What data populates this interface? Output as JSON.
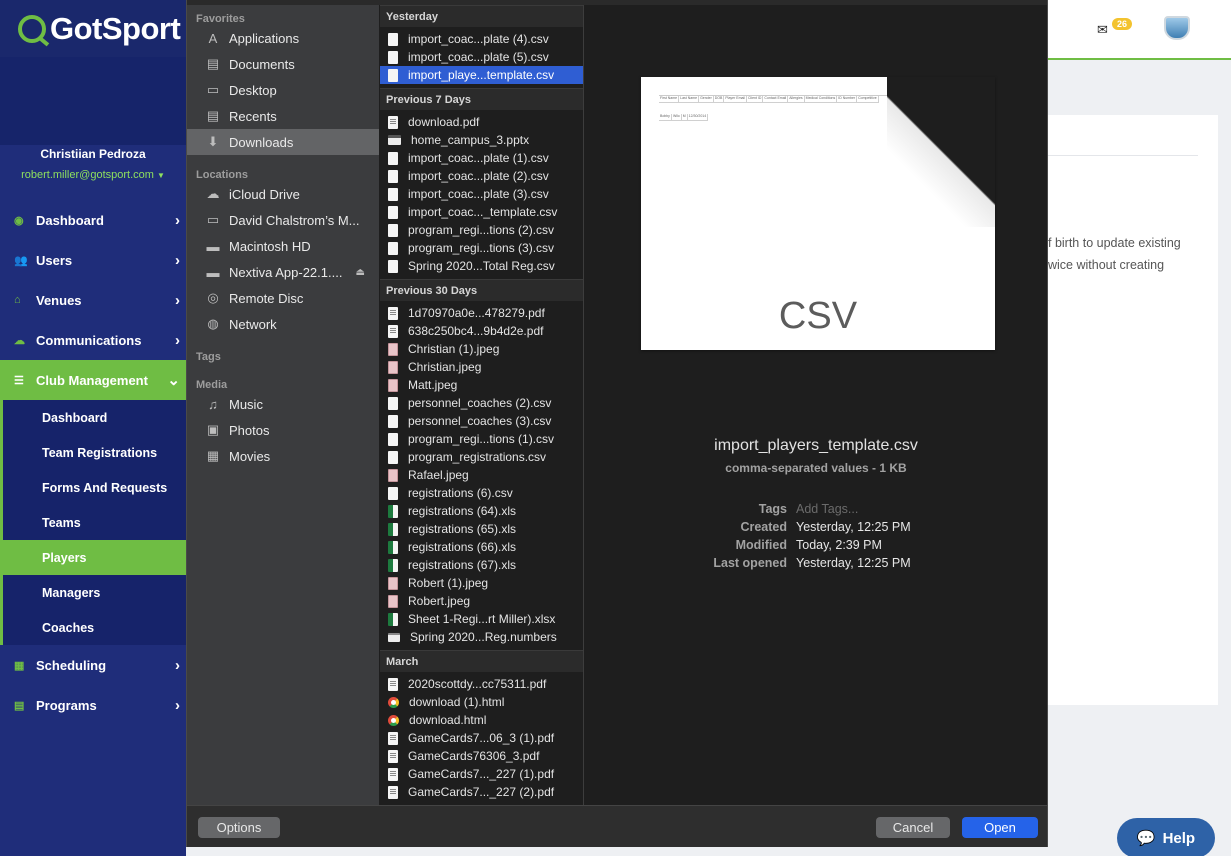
{
  "app": {
    "logo_text": "GotSport",
    "user_name": "Christiian Pedroza",
    "user_email": "robert.miller@gotsport.com",
    "nav": [
      {
        "label": "Dashboard",
        "icon": "dashboard-icon"
      },
      {
        "label": "Users",
        "icon": "users-icon"
      },
      {
        "label": "Venues",
        "icon": "home-icon"
      },
      {
        "label": "Communications",
        "icon": "chat-icon"
      },
      {
        "label": "Club Management",
        "icon": "list-icon"
      }
    ],
    "subnav": [
      "Dashboard",
      "Team Registrations",
      "Forms And Requests",
      "Teams",
      "Players",
      "Managers",
      "Coaches"
    ],
    "nav_bottom": [
      {
        "label": "Scheduling",
        "icon": "calendar-icon"
      },
      {
        "label": "Programs",
        "icon": "document-icon"
      }
    ],
    "mail_count": "26",
    "content_line1": "f birth to update existing",
    "content_line2": "wice without creating",
    "help_label": "Help"
  },
  "dialog": {
    "sidebar": {
      "favorites_heading": "Favorites",
      "favorites": [
        {
          "label": "Applications",
          "icon": "applications-icon"
        },
        {
          "label": "Documents",
          "icon": "documents-icon"
        },
        {
          "label": "Desktop",
          "icon": "desktop-icon"
        },
        {
          "label": "Recents",
          "icon": "recents-icon"
        },
        {
          "label": "Downloads",
          "icon": "downloads-icon"
        }
      ],
      "locations_heading": "Locations",
      "locations": [
        {
          "label": "iCloud Drive",
          "icon": "cloud-icon"
        },
        {
          "label": "David Chalstrom’s M...",
          "icon": "computer-icon"
        },
        {
          "label": "Macintosh HD",
          "icon": "disk-icon"
        },
        {
          "label": "Nextiva App-22.1....",
          "icon": "disk-icon"
        },
        {
          "label": "Remote Disc",
          "icon": "disc-icon"
        },
        {
          "label": "Network",
          "icon": "network-icon"
        }
      ],
      "tags_heading": "Tags",
      "media_heading": "Media",
      "media": [
        {
          "label": "Music",
          "icon": "music-icon"
        },
        {
          "label": "Photos",
          "icon": "camera-icon"
        },
        {
          "label": "Movies",
          "icon": "film-icon"
        }
      ]
    },
    "groups": [
      {
        "heading": "Yesterday",
        "files": [
          {
            "name": "import_coac...plate (4).csv",
            "type": "csv"
          },
          {
            "name": "import_coac...plate (5).csv",
            "type": "csv"
          },
          {
            "name": "import_playe...template.csv",
            "type": "csv",
            "selected": true
          }
        ]
      },
      {
        "heading": "Previous 7 Days",
        "files": [
          {
            "name": "download.pdf",
            "type": "pdf"
          },
          {
            "name": "home_campus_3.pptx",
            "type": "pptx"
          },
          {
            "name": "import_coac...plate (1).csv",
            "type": "csv"
          },
          {
            "name": "import_coac...plate (2).csv",
            "type": "csv"
          },
          {
            "name": "import_coac...plate (3).csv",
            "type": "csv"
          },
          {
            "name": "import_coac..._template.csv",
            "type": "csv"
          },
          {
            "name": "program_regi...tions (2).csv",
            "type": "csv"
          },
          {
            "name": "program_regi...tions (3).csv",
            "type": "csv"
          },
          {
            "name": "Spring 2020...Total Reg.csv",
            "type": "csv"
          }
        ]
      },
      {
        "heading": "Previous 30 Days",
        "files": [
          {
            "name": "1d70970a0e...478279.pdf",
            "type": "pdf"
          },
          {
            "name": "638c250bc4...9b4d2e.pdf",
            "type": "pdf"
          },
          {
            "name": "Christian (1).jpeg",
            "type": "jpeg"
          },
          {
            "name": "Christian.jpeg",
            "type": "jpeg"
          },
          {
            "name": "Matt.jpeg",
            "type": "jpeg"
          },
          {
            "name": "personnel_coaches (2).csv",
            "type": "csv"
          },
          {
            "name": "personnel_coaches (3).csv",
            "type": "csv"
          },
          {
            "name": "program_regi...tions (1).csv",
            "type": "csv"
          },
          {
            "name": "program_registrations.csv",
            "type": "csv"
          },
          {
            "name": "Rafael.jpeg",
            "type": "jpeg"
          },
          {
            "name": "registrations (6).csv",
            "type": "csv"
          },
          {
            "name": "registrations (64).xls",
            "type": "xls"
          },
          {
            "name": "registrations (65).xls",
            "type": "xls"
          },
          {
            "name": "registrations (66).xls",
            "type": "xls"
          },
          {
            "name": "registrations (67).xls",
            "type": "xls"
          },
          {
            "name": "Robert (1).jpeg",
            "type": "jpeg"
          },
          {
            "name": "Robert.jpeg",
            "type": "jpeg"
          },
          {
            "name": "Sheet 1-Regi...rt Miller).xlsx",
            "type": "xls"
          },
          {
            "name": "Spring 2020...Reg.numbers",
            "type": "numbers"
          }
        ]
      },
      {
        "heading": "March",
        "files": [
          {
            "name": "2020scottdy...cc75311.pdf",
            "type": "pdf"
          },
          {
            "name": "download (1).html",
            "type": "html"
          },
          {
            "name": "download.html",
            "type": "html"
          },
          {
            "name": "GameCards7...06_3 (1).pdf",
            "type": "pdf"
          },
          {
            "name": "GameCards76306_3.pdf",
            "type": "pdf"
          },
          {
            "name": "GameCards7..._227 (1).pdf",
            "type": "pdf"
          },
          {
            "name": "GameCards7..._227 (2).pdf",
            "type": "pdf"
          }
        ]
      }
    ],
    "preview": {
      "thumb_ext": "CSV",
      "thumb_headers": [
        "First Name",
        "Last Name",
        "Gender",
        "DOB",
        "Player Email",
        "Client ID",
        "Contact Email",
        "Allergies",
        "Medical Conditions",
        "ID Number",
        "Competitive"
      ],
      "thumb_row": [
        "Bobby",
        "Wilo",
        "M",
        "12/30/2014"
      ],
      "file_name": "import_players_template.csv",
      "file_type": "comma-separated values - 1 KB",
      "meta": [
        {
          "key": "Tags",
          "value": "Add Tags...",
          "placeholder": true
        },
        {
          "key": "Created",
          "value": "Yesterday, 12:25 PM"
        },
        {
          "key": "Modified",
          "value": "Today, 2:39 PM"
        },
        {
          "key": "Last opened",
          "value": "Yesterday, 12:25 PM"
        }
      ]
    },
    "buttons": {
      "options": "Options",
      "cancel": "Cancel",
      "open": "Open"
    }
  }
}
